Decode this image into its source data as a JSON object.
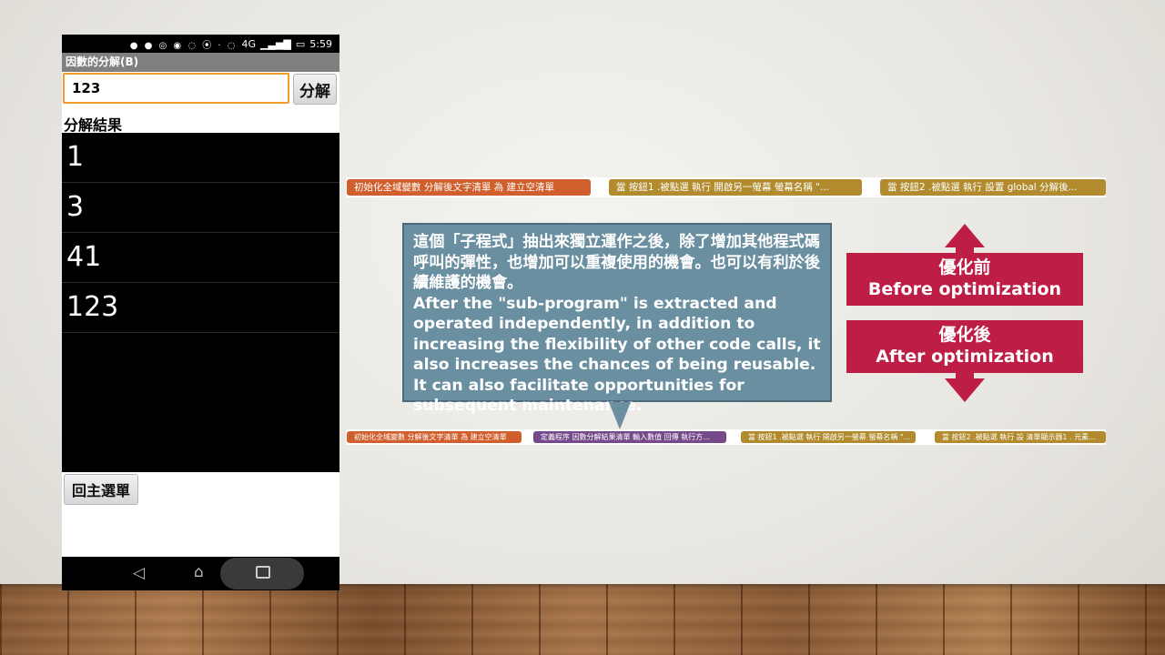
{
  "phone": {
    "status_time": "5:59",
    "status_network": "4G",
    "app_title": "因數的分解(B)",
    "input_value": "123",
    "factor_button": "分解",
    "result_label": "分解結果",
    "results": [
      "1",
      "3",
      "41",
      "123"
    ],
    "back_button": "回主選單"
  },
  "blocks_top": [
    "初始化全域變數 分解後文字清單 為 建立空清單",
    "當 按鈕1 .被點選 執行 開啟另一螢幕 螢幕名稱 \"...",
    "當 按鈕2 .被點選 執行 設置 global 分解後..."
  ],
  "blocks_bottom": [
    "初始化全域變數 分解後文字清單 為 建立空清單",
    "定義程序 因數分解結果清單  輸入數值 回傳 執行方...",
    "當 按鈕1 .被點選 執行 開啟另一螢幕 螢幕名稱 \"...",
    "當 按鈕2 .被點選 執行 設 清單顯示器1 . 元素..."
  ],
  "callout": {
    "zh": "這個「子程式」抽出來獨立運作之後，除了增加其他程式碼呼叫的彈性，也增加可以重複使用的機會。也可以有利於後續維護的機會。",
    "en": "After the \"sub-program\" is extracted and operated independently, in addition to increasing the flexibility of other code calls, it also increases the chances of being reusable. It can also facilitate opportunities for subsequent maintenance."
  },
  "legend": {
    "before_zh": "優化前",
    "before_en": "Before optimization",
    "after_zh": "優化後",
    "after_en": "After optimization"
  },
  "colors": {
    "accent": "#be1e45",
    "callout": "#6a8fa0",
    "block_orange": "#d05f2d",
    "block_gold": "#b18b2e",
    "block_purple": "#764a8a",
    "input_border": "#f39a28"
  }
}
